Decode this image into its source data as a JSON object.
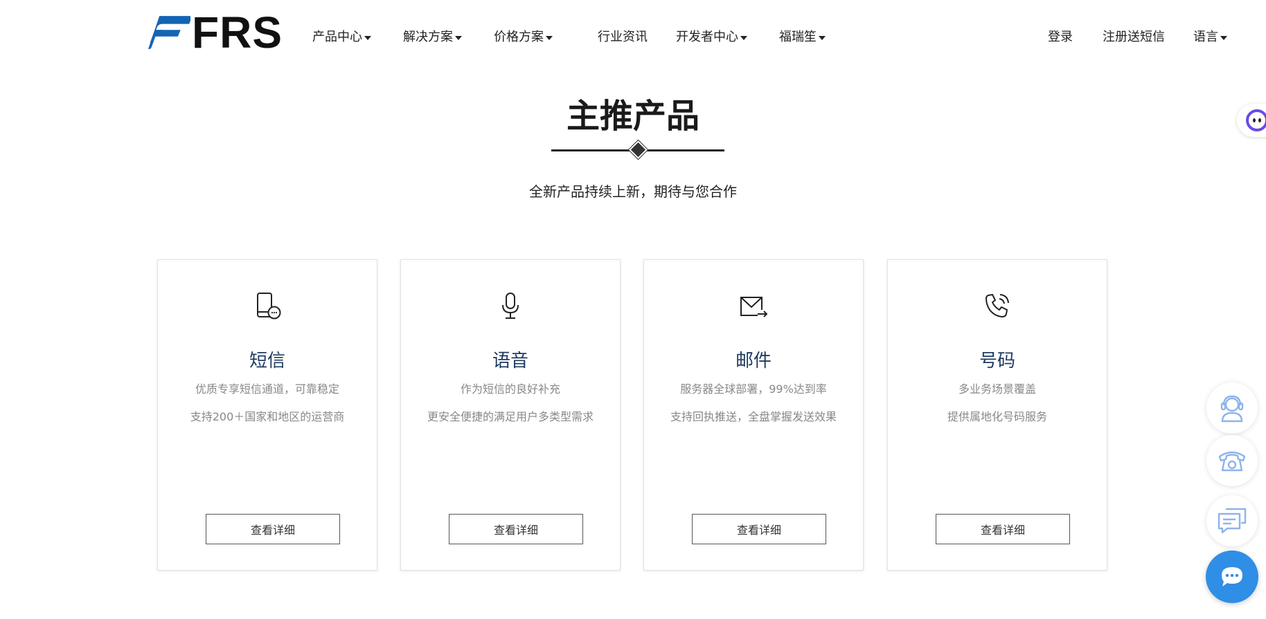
{
  "brand": {
    "name": "FRS",
    "color": "#1464b4"
  },
  "nav": {
    "items": [
      {
        "label": "产品中心",
        "dropdown": true
      },
      {
        "label": "解决方案",
        "dropdown": true
      },
      {
        "label": "价格方案",
        "dropdown": true
      },
      {
        "label": "行业资讯",
        "dropdown": false
      },
      {
        "label": "开发者中心",
        "dropdown": true
      },
      {
        "label": "福瑞笙",
        "dropdown": true
      }
    ],
    "login": "登录",
    "register": "注册送短信",
    "language": "语言"
  },
  "section": {
    "title": "主推产品",
    "subtitle": "全新产品持续上新，期待与您合作"
  },
  "cards": [
    {
      "title": "短信",
      "line1": "优质专享短信通道，可靠稳定",
      "line2": "支持200＋国家和地区的运营商",
      "button": "查看详细",
      "icon": "phone-message-icon"
    },
    {
      "title": "语音",
      "line1": "作为短信的良好补充",
      "line2": "更安全便捷的满足用户多类型需求",
      "button": "查看详细",
      "icon": "microphone-icon"
    },
    {
      "title": "邮件",
      "line1": "服务器全球部署，99%达到率",
      "line2": "支持回执推送，全盘掌握发送效果",
      "button": "查看详细",
      "icon": "mail-send-icon"
    },
    {
      "title": "号码",
      "line1": "多业务场景覆盖",
      "line2": "提供属地化号码服务",
      "button": "查看详细",
      "icon": "phone-call-icon"
    }
  ],
  "floating": {
    "accent": "#2f8ee6",
    "widgets": [
      "customer-service-icon",
      "telephone-icon",
      "feedback-icon",
      "chat-icon"
    ]
  }
}
